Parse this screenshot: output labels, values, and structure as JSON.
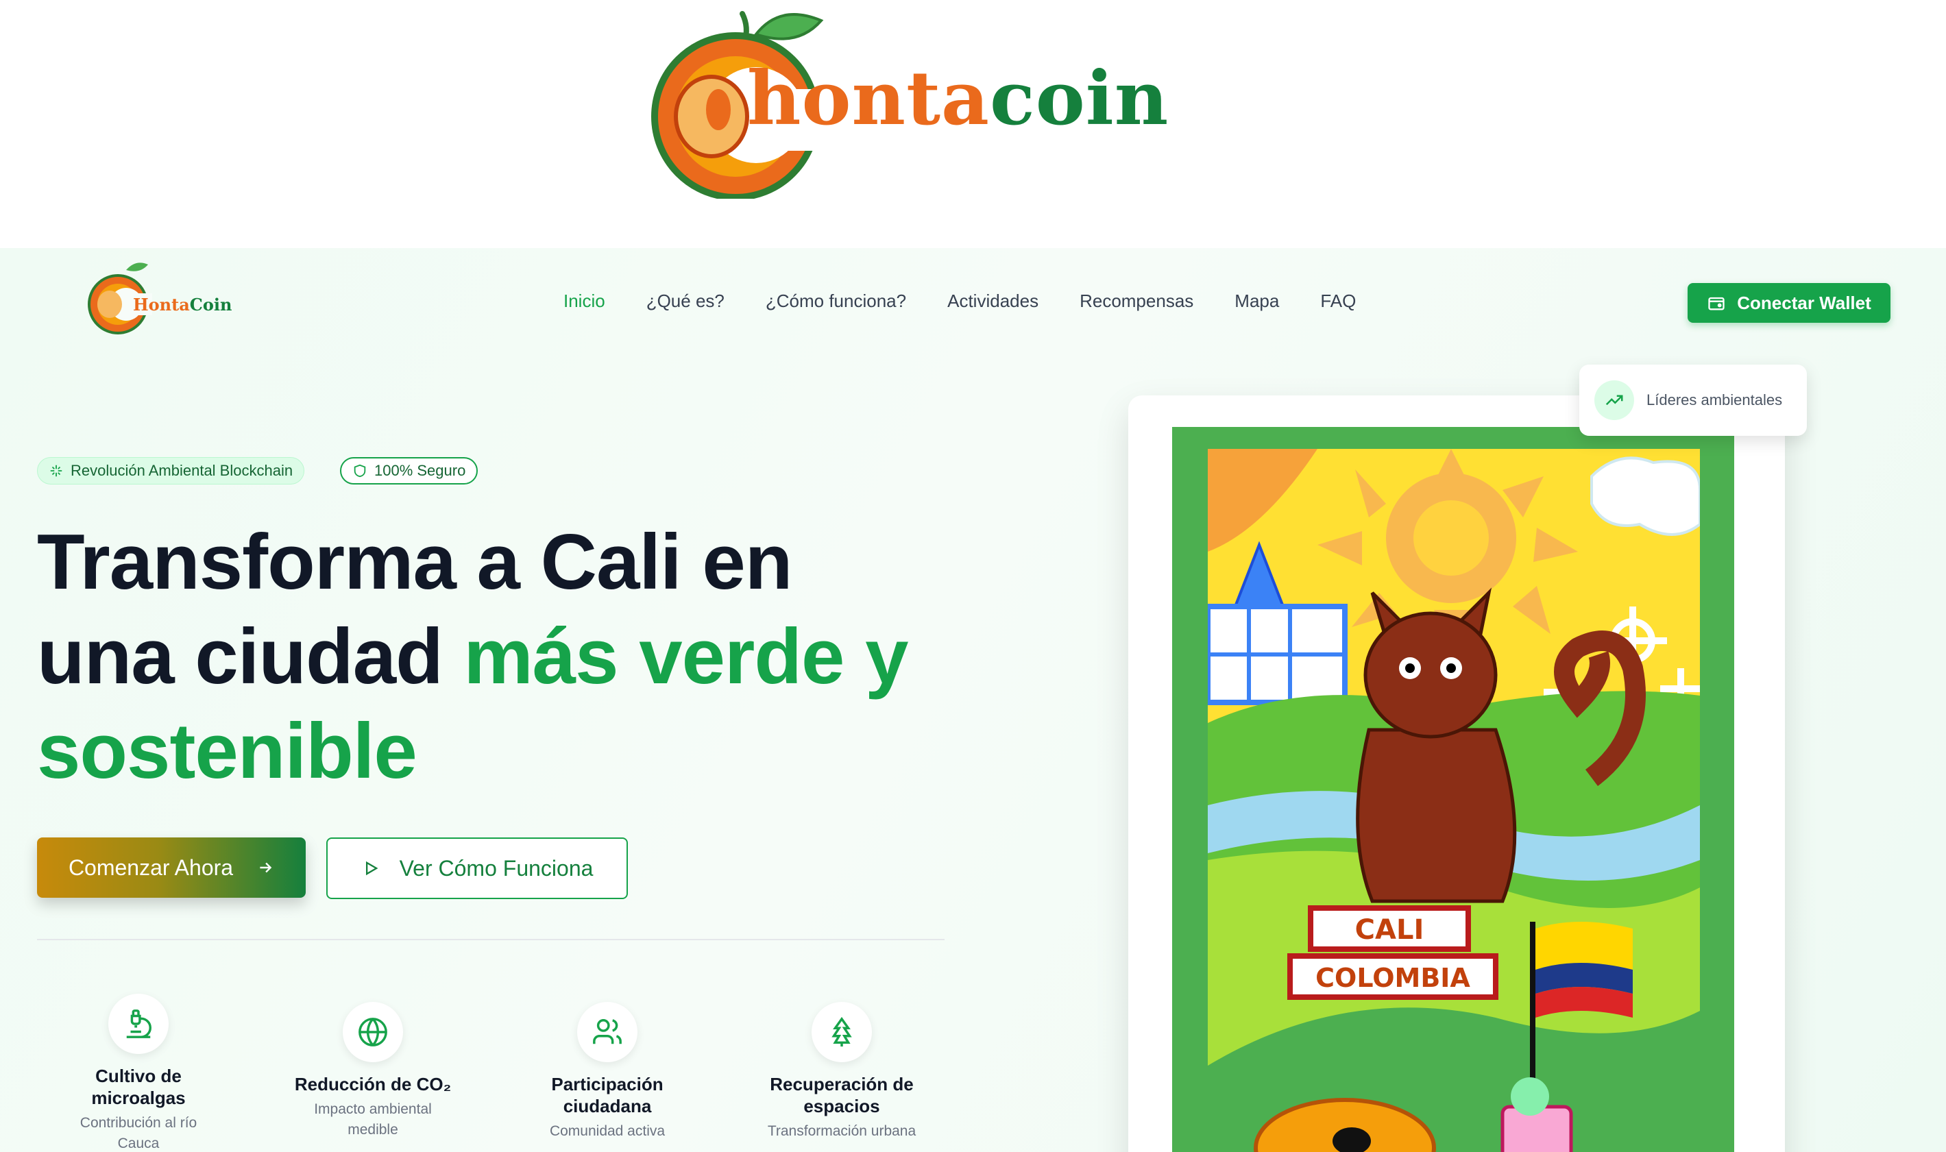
{
  "banner": {
    "brand_part1": "C",
    "brand_part2": "honta",
    "brand_part3": "coin"
  },
  "nav": {
    "logo_part1": "Honta",
    "logo_part2": "Coin",
    "links": [
      {
        "label": "Inicio",
        "active": true
      },
      {
        "label": "¿Qué es?",
        "active": false
      },
      {
        "label": "¿Cómo funciona?",
        "active": false
      },
      {
        "label": "Actividades",
        "active": false
      },
      {
        "label": "Recompensas",
        "active": false
      },
      {
        "label": "Mapa",
        "active": false
      },
      {
        "label": "FAQ",
        "active": false
      }
    ],
    "wallet_button": "Conectar Wallet"
  },
  "hero": {
    "badges": [
      "Revolución Ambiental Blockchain",
      "100% Seguro"
    ],
    "headline_line1": "Transforma a Cali en",
    "headline_line2_plain": "una ciudad ",
    "headline_line2_green": "más verde y",
    "headline_line3_green": "sostenible",
    "cta_primary": "Comenzar Ahora",
    "cta_secondary": "Ver Cómo Funciona"
  },
  "features": [
    {
      "title_line1": "Cultivo de",
      "title_line2": "microalgas",
      "subtitle_line1": "Contribución al río",
      "subtitle_line2": "Cauca",
      "icon": "microscope-icon"
    },
    {
      "title_line1": "Reducción de CO₂",
      "title_line2": "",
      "subtitle_line1": "Impacto ambiental",
      "subtitle_line2": "medible",
      "icon": "globe-icon"
    },
    {
      "title_line1": "Participación",
      "title_line2": "ciudadana",
      "subtitle_line1": "Comunidad activa",
      "subtitle_line2": "",
      "icon": "users-icon"
    },
    {
      "title_line1": "Recuperación de",
      "title_line2": "espacios",
      "subtitle_line1": "Transformación urbana",
      "subtitle_line2": "",
      "icon": "tree-icon"
    }
  ],
  "artwork": {
    "float_card_label": "Líderes ambientales",
    "sign_top": "CALI",
    "sign_bottom": "COLOMBIA"
  },
  "colors": {
    "brand_green": "#16a34a",
    "brand_orange": "#ea6a1c",
    "text_dark": "#111827"
  }
}
